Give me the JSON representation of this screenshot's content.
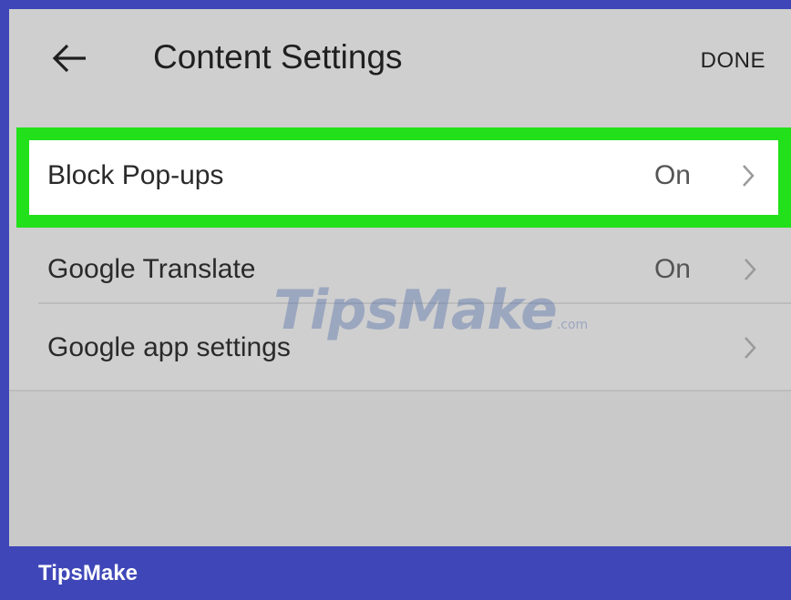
{
  "header": {
    "back_icon": "arrow-left-icon",
    "title": "Content Settings",
    "done_label": "DONE"
  },
  "settings": [
    {
      "label": "Block Pop-ups",
      "value": "On",
      "icon": "chevron-right-icon",
      "highlighted": true
    },
    {
      "label": "Google Translate",
      "value": "On",
      "icon": "chevron-right-icon",
      "highlighted": false
    },
    {
      "label": "Google app settings",
      "value": "",
      "icon": "chevron-right-icon",
      "highlighted": false
    }
  ],
  "watermark": {
    "text": "TipsMake",
    "suffix": ".com"
  },
  "footer": {
    "brand": "TipsMake"
  },
  "colors": {
    "frame": "#3f47b8",
    "highlight": "#22e01a",
    "background": "#cfcfcf"
  }
}
